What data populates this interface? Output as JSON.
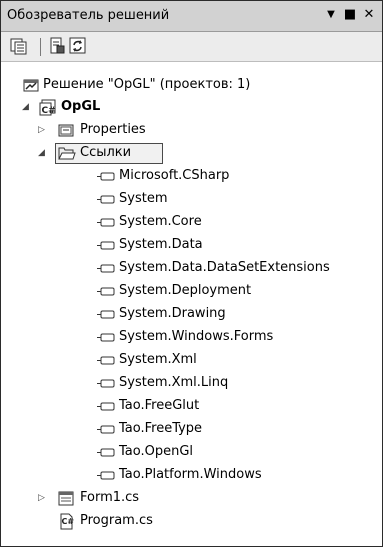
{
  "panel": {
    "title": "Обозреватель решений",
    "controls": {
      "dropdown": "▼",
      "maximize": "■",
      "close": "✕"
    }
  },
  "tree": {
    "solution": "Решение \"OpGL\" (проектов: 1)",
    "project": "OpGL",
    "properties": "Properties",
    "references_folder": "Ссылки",
    "references": [
      "Microsoft.CSharp",
      "System",
      "System.Core",
      "System.Data",
      "System.Data.DataSetExtensions",
      "System.Deployment",
      "System.Drawing",
      "System.Windows.Forms",
      "System.Xml",
      "System.Xml.Linq",
      "Tao.FreeGlut",
      "Tao.FreeType",
      "Tao.OpenGl",
      "Tao.Platform.Windows"
    ],
    "files": [
      "Form1.cs",
      "Program.cs"
    ]
  }
}
